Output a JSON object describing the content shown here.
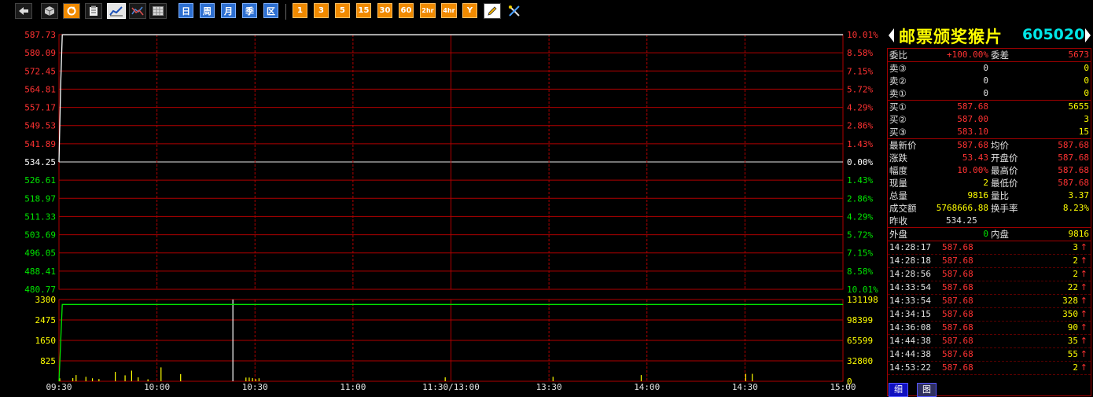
{
  "toolbar": {
    "system_icons": [
      "back-icon",
      "cube-icon",
      "refresh-icon",
      "clipboard-icon",
      "intraday-chart-icon",
      "kline-chart-icon",
      "table-icon"
    ],
    "period_buttons": [
      "日",
      "周",
      "月",
      "季",
      "区"
    ],
    "minute_buttons": [
      "1",
      "3",
      "5",
      "15",
      "30",
      "60",
      "2hr",
      "4hr",
      "Y"
    ],
    "tool_icons": [
      "pencil-icon",
      "tools-icon"
    ]
  },
  "stock": {
    "name": "邮票颁奖猴片",
    "code": "605020"
  },
  "chart_data": [
    {
      "type": "line",
      "title": "",
      "x_ticks": [
        "09:30",
        "10:00",
        "10:30",
        "11:00",
        "11:30/13:00",
        "13:30",
        "14:00",
        "14:30",
        "15:00"
      ],
      "price_ticks": [
        "587.73",
        "580.09",
        "572.45",
        "564.81",
        "557.17",
        "549.53",
        "541.89",
        "534.25",
        "526.61",
        "518.97",
        "511.33",
        "503.69",
        "496.05",
        "488.41",
        "480.77"
      ],
      "pct_ticks": [
        "10.01%",
        "8.58%",
        "7.15%",
        "5.72%",
        "4.29%",
        "2.86%",
        "1.43%",
        "0.00%",
        "1.43%",
        "2.86%",
        "4.29%",
        "5.72%",
        "7.15%",
        "8.58%",
        "10.01%"
      ],
      "ylim": [
        480.77,
        587.73
      ],
      "prev_close": 534.25,
      "series": [
        {
          "color": "#ffffff",
          "x": [
            0,
            0.5,
            1,
            240
          ],
          "values": [
            534.25,
            566.0,
            587.68,
            587.68
          ]
        }
      ]
    },
    {
      "type": "bar",
      "title": "",
      "left_ticks": [
        "3300",
        "2475",
        "1650",
        "825",
        ""
      ],
      "right_ticks": [
        "131198",
        "98399",
        "65599",
        "32800",
        "0"
      ],
      "ylim": [
        0,
        3300
      ],
      "avg_volume_line": {
        "color": "#00e600",
        "x": [
          0,
          1,
          240
        ],
        "values": [
          0,
          3100,
          3100
        ]
      },
      "volume_x": [
        0,
        4,
        5,
        8,
        10,
        12,
        17,
        20,
        22,
        24,
        27,
        31,
        37,
        53,
        57,
        58,
        59,
        60,
        61,
        118,
        151,
        178,
        210,
        212
      ],
      "volume_values": [
        120,
        130,
        250,
        180,
        120,
        90,
        380,
        240,
        430,
        160,
        80,
        560,
        290,
        3300,
        150,
        150,
        130,
        90,
        120,
        160,
        180,
        250,
        300,
        300
      ]
    }
  ],
  "quote": {
    "weibi_label": "委比",
    "weibi_value": "+100.00%",
    "weicha_label": "委差",
    "weicha_value": "5673",
    "asks": [
      {
        "label": "卖③",
        "price": "0",
        "vol": "0"
      },
      {
        "label": "卖②",
        "price": "0",
        "vol": "0"
      },
      {
        "label": "卖①",
        "price": "0",
        "vol": "0"
      }
    ],
    "bids": [
      {
        "label": "买①",
        "price": "587.68",
        "vol": "5655"
      },
      {
        "label": "买②",
        "price": "587.00",
        "vol": "3"
      },
      {
        "label": "买③",
        "price": "583.10",
        "vol": "15"
      }
    ],
    "stats": [
      {
        "l1": "最新价",
        "v1": "587.68",
        "c1": "red",
        "l2": "均价",
        "v2": "587.68",
        "c2": "red"
      },
      {
        "l1": "涨跌",
        "v1": "53.43",
        "c1": "red",
        "l2": "开盘价",
        "v2": "587.68",
        "c2": "red"
      },
      {
        "l1": "幅度",
        "v1": "10.00%",
        "c1": "red",
        "l2": "最高价",
        "v2": "587.68",
        "c2": "red"
      },
      {
        "l1": "现量",
        "v1": "2",
        "c1": "yel",
        "l2": "最低价",
        "v2": "587.68",
        "c2": "red"
      },
      {
        "l1": "总量",
        "v1": "9816",
        "c1": "yel",
        "l2": "量比",
        "v2": "3.37",
        "c2": "yel"
      },
      {
        "l1": "成交额",
        "v1": "5768666.88",
        "c1": "yel",
        "l2": "换手率",
        "v2": "8.23%",
        "c2": "yel"
      }
    ],
    "prev_label": "昨收",
    "prev_value": "534.25",
    "outer_label": "外盘",
    "outer_value": "0",
    "inner_label": "内盘",
    "inner_value": "9816"
  },
  "ticks": [
    {
      "time": "14:28:17",
      "price": "587.68",
      "vol": "3"
    },
    {
      "time": "14:28:18",
      "price": "587.68",
      "vol": "2"
    },
    {
      "time": "14:28:56",
      "price": "587.68",
      "vol": "2"
    },
    {
      "time": "14:33:54",
      "price": "587.68",
      "vol": "22"
    },
    {
      "time": "14:33:54",
      "price": "587.68",
      "vol": "328"
    },
    {
      "time": "14:34:15",
      "price": "587.68",
      "vol": "350"
    },
    {
      "time": "14:36:08",
      "price": "587.68",
      "vol": "90"
    },
    {
      "time": "14:44:38",
      "price": "587.68",
      "vol": "35"
    },
    {
      "time": "14:44:38",
      "price": "587.68",
      "vol": "55"
    },
    {
      "time": "14:53:22",
      "price": "587.68",
      "vol": "2"
    }
  ],
  "tick_arrow": "↑",
  "tabs": {
    "detail": "细",
    "chart": "图"
  },
  "colors": {
    "grid": "#b00000",
    "up": "#ff3232",
    "down": "#00e600",
    "neutral": "#ffffff",
    "volume_scale": "#ffff00"
  }
}
